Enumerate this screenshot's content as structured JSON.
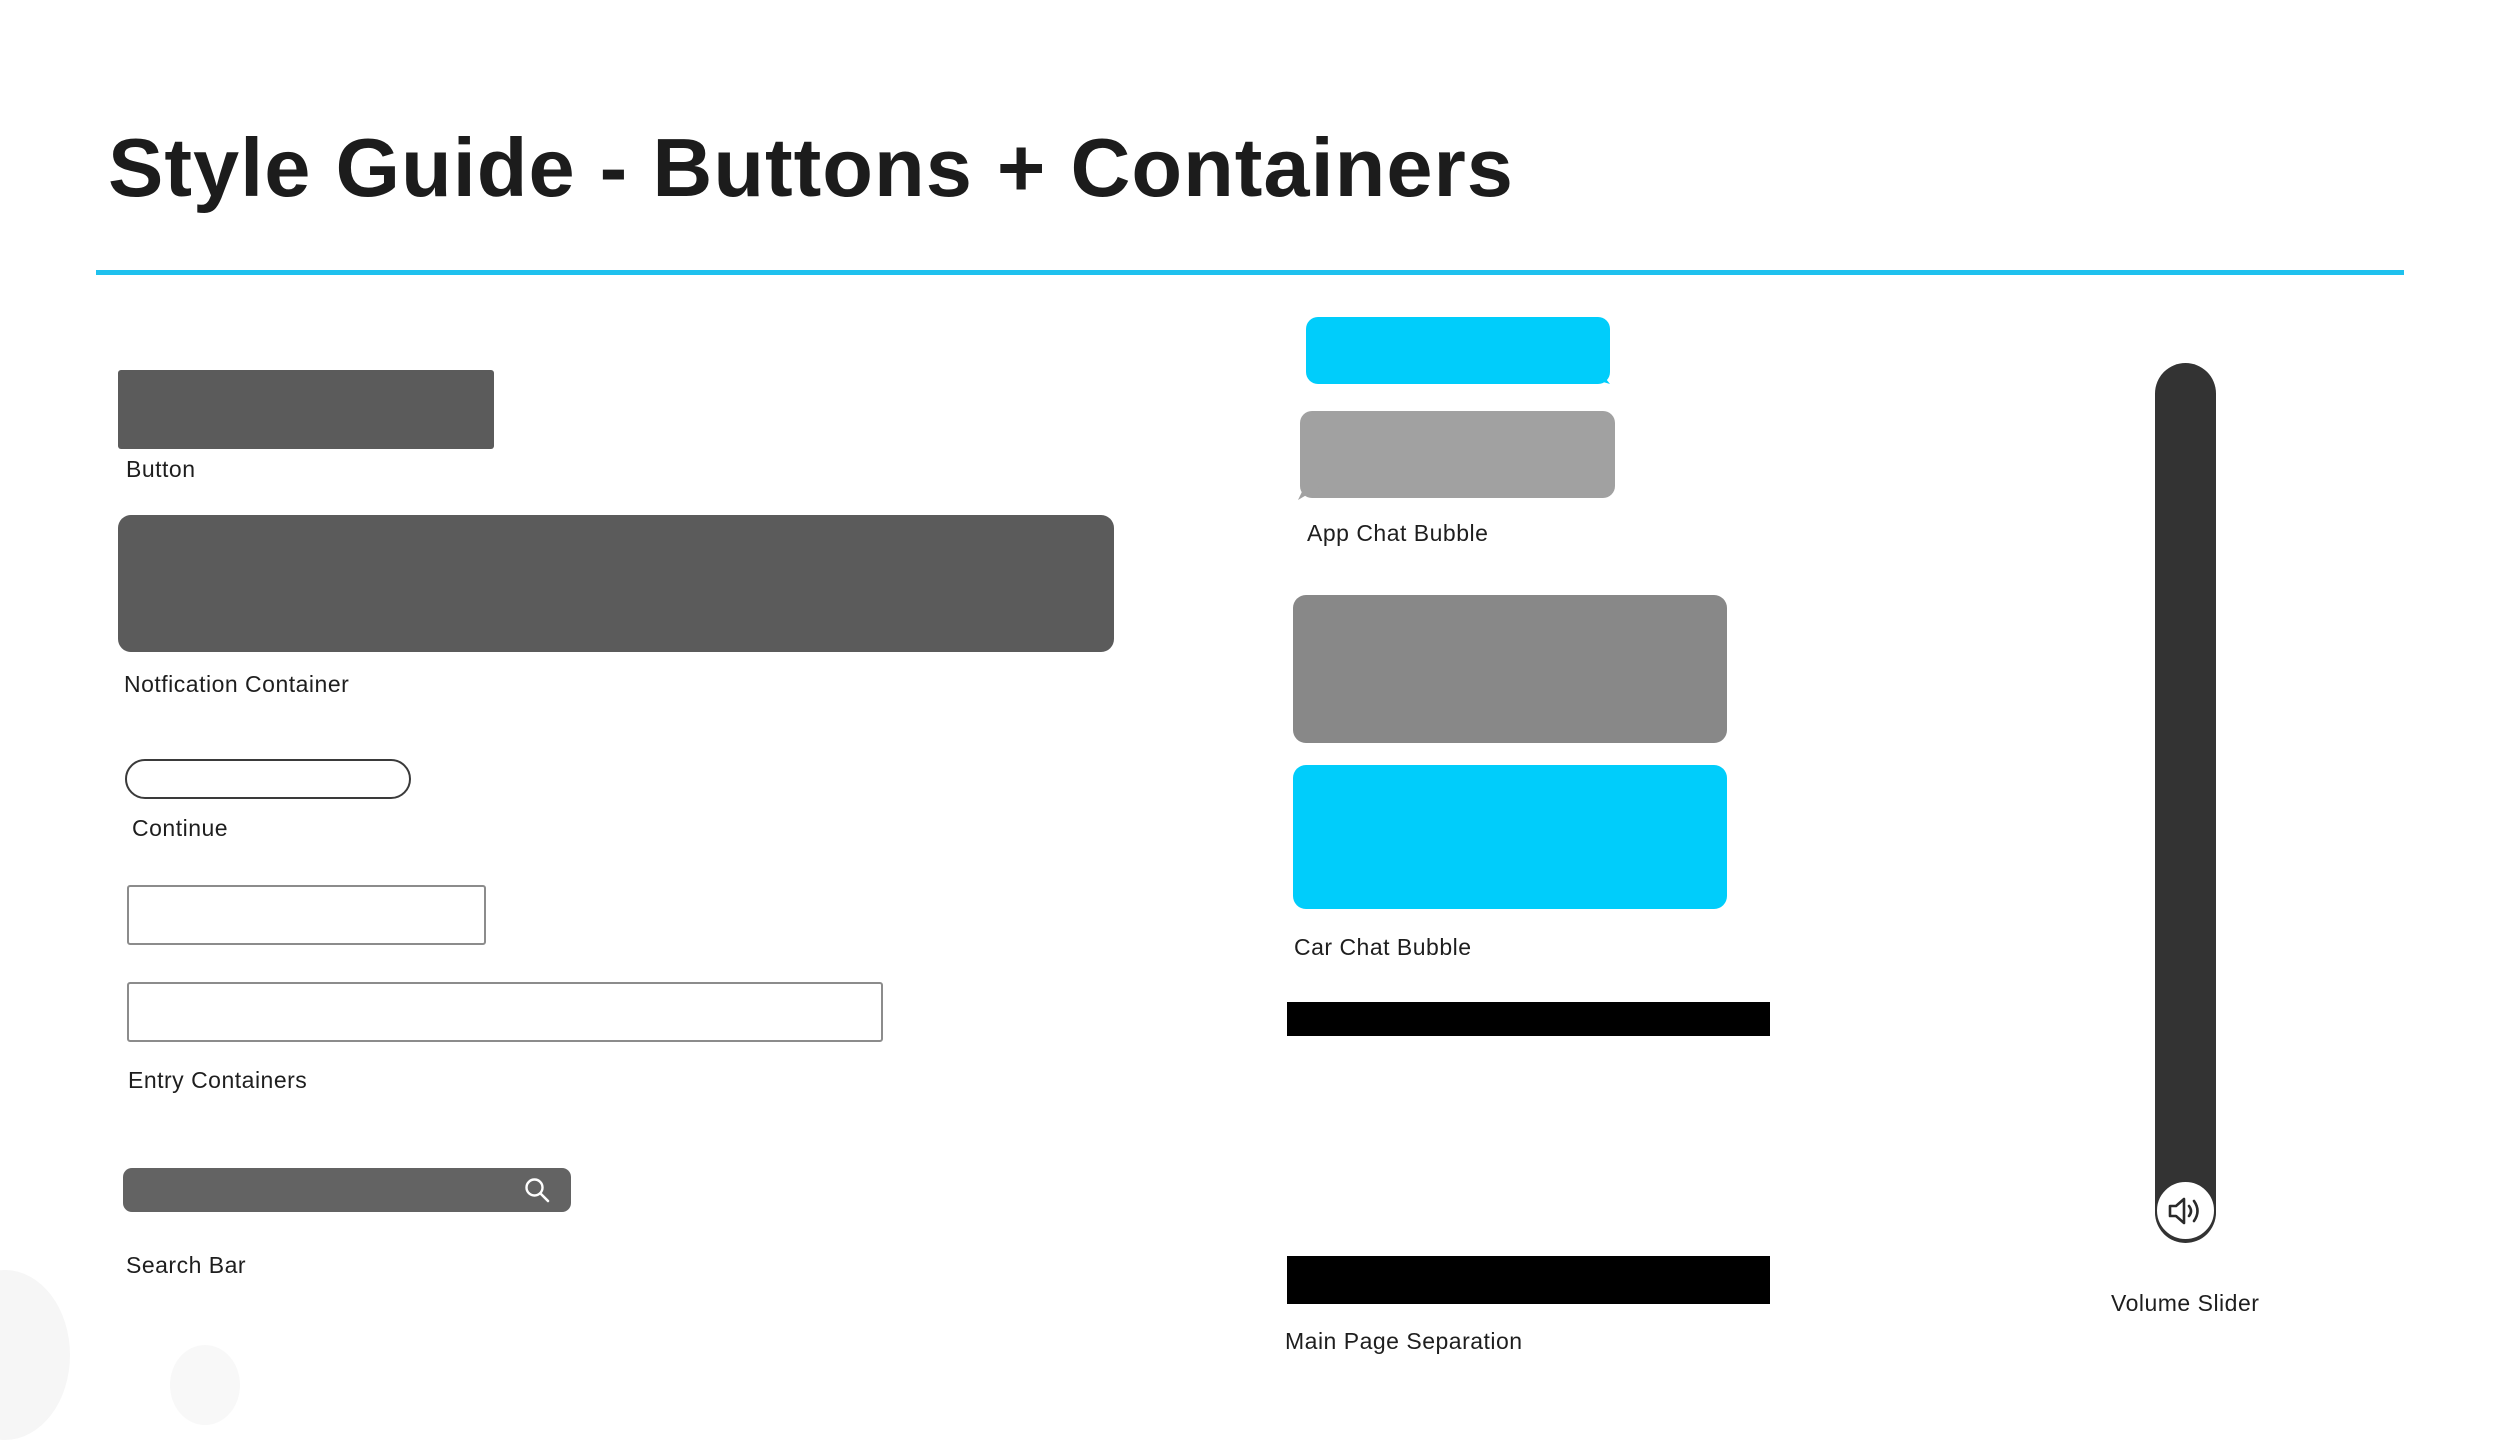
{
  "page": {
    "title": "Style Guide - Buttons + Containers",
    "accent_color": "#1fc1ee"
  },
  "left_column": {
    "button_caption": "Button",
    "notification_caption": "Notfication Container",
    "continue_caption": "Continue",
    "entry_caption": "Entry Containers",
    "search_caption": "Search Bar",
    "search_icon": "search-icon",
    "fill_color": "#5b5b5b"
  },
  "middle_column": {
    "app_chat_caption": "App Chat Bubble",
    "car_chat_caption": "Car Chat Bubble",
    "separation_caption": "Main Page Separation",
    "bubble_blue": "#00cdfb",
    "bubble_gray": "#a1a1a1",
    "car_bubble_gray": "#888888",
    "separator_color": "#000000"
  },
  "right_column": {
    "volume_caption": "Volume Slider",
    "volume_icon": "speaker-volume-icon",
    "track_color": "#333333",
    "volume_level": 0.0
  }
}
